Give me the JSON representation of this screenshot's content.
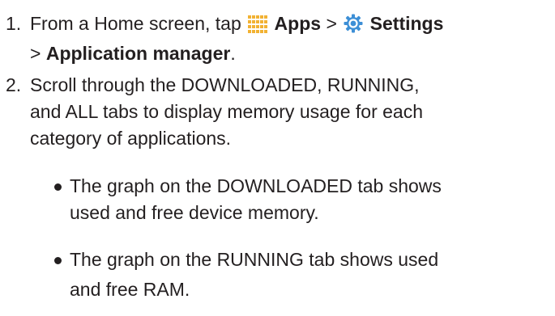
{
  "steps": [
    {
      "number": "1.",
      "line1": {
        "prefix": "From a Home screen, tap",
        "apps_label": "Apps",
        "separator": ">",
        "settings_label": "Settings"
      },
      "line2": {
        "separator": ">",
        "app_manager_label": "Application manager",
        "suffix": "."
      },
      "icons": [
        "apps-grid-icon",
        "settings-gear-icon"
      ],
      "icon_colors": {
        "apps_grid": "#f2b233",
        "settings_gear": "#3d8fd6"
      }
    },
    {
      "number": "2.",
      "lines": [
        "Scroll through the DOWNLOADED, RUNNING,",
        "and ALL tabs to display memory usage for each",
        "category of applications."
      ]
    }
  ],
  "bullets": [
    {
      "lines": [
        "The graph on the DOWNLOADED tab shows",
        "used and free device memory."
      ]
    },
    {
      "lines": [
        "The graph on the RUNNING tab shows used",
        "and free RAM."
      ]
    }
  ]
}
